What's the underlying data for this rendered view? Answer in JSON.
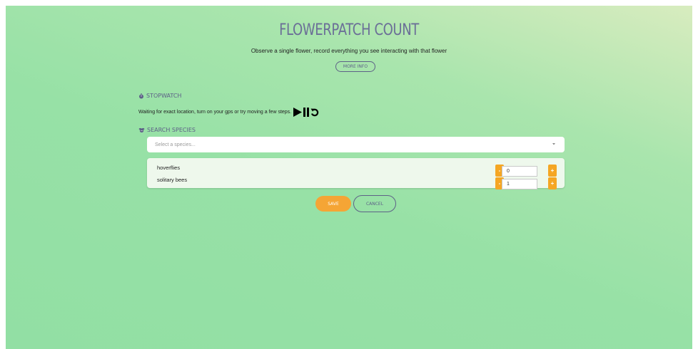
{
  "page": {
    "title": "FLOWERPATCH COUNT",
    "subtitle": "Observe a single flower, record everything you see interacting with that flower",
    "more_info_label": "MORE INFO"
  },
  "stopwatch": {
    "label": "STOPWATCH",
    "status": "Waiting for exact location, turn on your gps or try moving a few steps.",
    "icons": [
      "play-icon",
      "pause-icon",
      "reset-icon"
    ]
  },
  "search": {
    "label": "SEARCH SPECIES",
    "placeholder": "Select a species..."
  },
  "species": [
    {
      "name": "hoverflies",
      "count": "0"
    },
    {
      "name": "solitary bees",
      "count": "1"
    }
  ],
  "stepper": {
    "minus": "-",
    "plus": "+"
  },
  "actions": {
    "save_label": "SAVE",
    "cancel_label": "CANCEL"
  },
  "colors": {
    "accent": "#f5a535",
    "heading": "#6b6f97",
    "background_top": "#d8ecbf",
    "background": "#97e1a6"
  }
}
